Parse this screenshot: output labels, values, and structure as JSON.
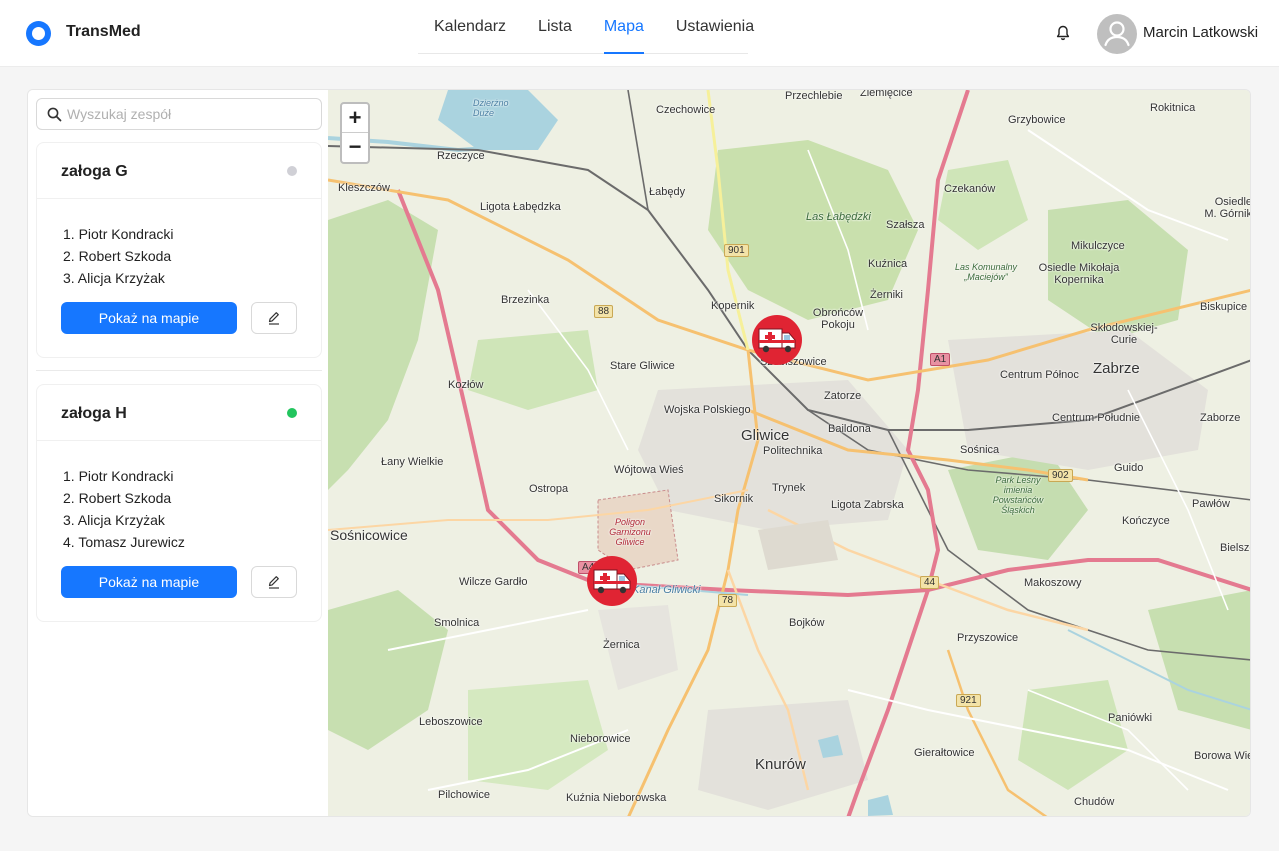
{
  "app": {
    "brand": "TransMed"
  },
  "nav": [
    {
      "label": "Kalendarz",
      "active": false
    },
    {
      "label": "Lista",
      "active": false
    },
    {
      "label": "Mapa",
      "active": true
    },
    {
      "label": "Ustawienia",
      "active": false
    }
  ],
  "user": {
    "name": "Marcin Latkowski",
    "icon": "user-avatar-icon"
  },
  "icons": {
    "notification": "bell-icon",
    "search": "search-icon",
    "edit": "edit-icon",
    "marker": "ambulance-icon"
  },
  "colors": {
    "accent": "#1677ff",
    "status_offline": "#d0d0d6",
    "status_online": "#22c55e",
    "marker": "#e02433"
  },
  "sidebar": {
    "search": {
      "placeholder": "Wyszukaj zespół",
      "value": ""
    },
    "teams": [
      {
        "name": "załoga G",
        "status": "offline",
        "members": [
          "1. Piotr Kondracki",
          "2. Robert Szkoda",
          "3. Alicja Krzyżak"
        ],
        "show_button": "Pokaż na mapie"
      },
      {
        "name": "załoga H",
        "status": "online",
        "members": [
          "1. Piotr Kondracki",
          "2. Robert Szkoda",
          "3. Alicja Krzyżak",
          "4. Tomasz Jurewicz"
        ],
        "show_button": "Pokaż na mapie"
      }
    ]
  },
  "map": {
    "zoom_in": "+",
    "zoom_out": "−",
    "labels": {
      "gliwice": "Gliwice",
      "zabrze": "Zabrze",
      "knurow": "Knurów",
      "czechowice": "Czechowice",
      "przechlebie": "Przechlebie",
      "ziemiecice": "Ziemięcice",
      "rokitnica": "Rokitnica",
      "grzybowice": "Grzybowice",
      "rzeczyce": "Rzeczyce",
      "kleszczow": "Kleszczów",
      "labedy": "Łabędy",
      "ligota_labedzka": "Ligota Łabędzka",
      "las_labedzki": "Las Łabędzki",
      "czekanow": "Czekanów",
      "osiedle_mgornik": "Osiedle M. Górnik",
      "szalsza": "Szałsza",
      "kuznica": "Kuźnica",
      "mikulczyce": "Mikulczyce",
      "zerniki": "Żerniki",
      "osiedle_kopernika": "Osiedle Mikołaja Kopernika",
      "las_komunalny": "Las Komunalny „Maciejów”",
      "brzezinka": "Brzezinka",
      "kopernik": "Kopernik",
      "obroncow": "Obrońców Pokoju",
      "biskupice": "Biskupice",
      "skladowskiej": "Skłodowskiej-Curie",
      "stare_gliwice": "Stare Gliwice",
      "szobiszowice": "Szobiszowice",
      "centrum_polnoc": "Centrum Północ",
      "kozlow": "Kozłów",
      "wojska_polskiego": "Wojska Polskiego",
      "zatorze": "Zatorze",
      "baildona": "Baildona",
      "centrum_poludnie": "Centrum Południe",
      "zaborze": "Zaborze",
      "politechnika": "Politechnika",
      "sosnica": "Sośnica",
      "laly_wielkie": "Łany Wielkie",
      "wojtowa_wies": "Wójtowa Wieś",
      "ostropa": "Ostropa",
      "trynek": "Trynek",
      "sikornik": "Sikornik",
      "guido": "Guido",
      "ligota_zabrska": "Ligota Zabrska",
      "park_lesny": "Park Leśny imienia Powstańców Śląskich",
      "pawlow": "Pawłów",
      "sosnicowice": "Sośnicowice",
      "poligon": "Poligon Garnizonu Gliwice",
      "konczyce": "Kończyce",
      "bielszowice": "Bielszow",
      "wilcze_gardlo": "Wilcze Gardło",
      "makoszowy": "Makoszowy",
      "smolnica": "Smolnica",
      "bojkow": "Bojków",
      "przyszowice": "Przyszowice",
      "zernica": "Żernica",
      "leboszowice": "Leboszowice",
      "paniowki": "Paniówki",
      "nieborowice": "Nieborowice",
      "gieraltowice": "Gierałtowice",
      "borowa_wies": "Borowa Wieś",
      "pilchowice": "Pilchowice",
      "kuznia_nieborowska": "Kuźnia Nieborowska",
      "chudow": "Chudów",
      "r901": "901",
      "r88": "88",
      "a1": "A1",
      "r902": "902",
      "r44": "44",
      "r78": "78",
      "r921": "921",
      "a4": "A4",
      "kanal": "Kanał Gliwicki",
      "dzierzno": "Dzierżno Duże"
    }
  }
}
